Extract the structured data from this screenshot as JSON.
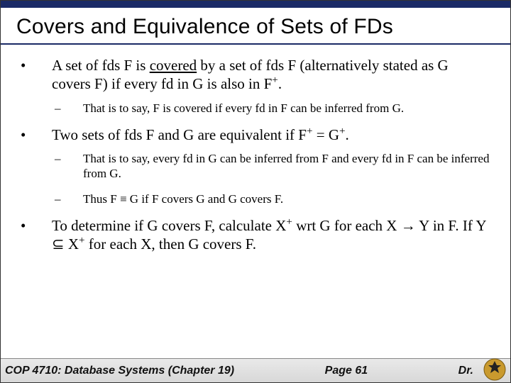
{
  "title": "Covers and Equivalence of Sets of FDs",
  "bullets": [
    {
      "text_html": "A set of fds F is <span class='underline'>covered</span> by a set of fds F (alternatively stated as G covers F) if every fd in G is also in F<sup>+</sup>.",
      "subs": [
        "That is to say, F is covered if every fd in F can be inferred from G."
      ]
    },
    {
      "text_html": "Two sets of fds F and G are equivalent if F<sup>+</sup> = G<sup>+</sup>.",
      "subs": [
        "That is to say, every fd in G can be inferred from F and every fd in F can be inferred from G.",
        "Thus F ≡ G if F covers G and G covers F."
      ]
    },
    {
      "text_html": "To determine if G covers F, calculate X<sup>+</sup> wrt G for each X → Y in F. If Y ⊆ X<sup>+</sup> for each X, then G covers F.",
      "subs": []
    }
  ],
  "footer": {
    "course": "COP 4710: Database Systems  (Chapter 19)",
    "page": "Page 61",
    "author": "Dr."
  }
}
